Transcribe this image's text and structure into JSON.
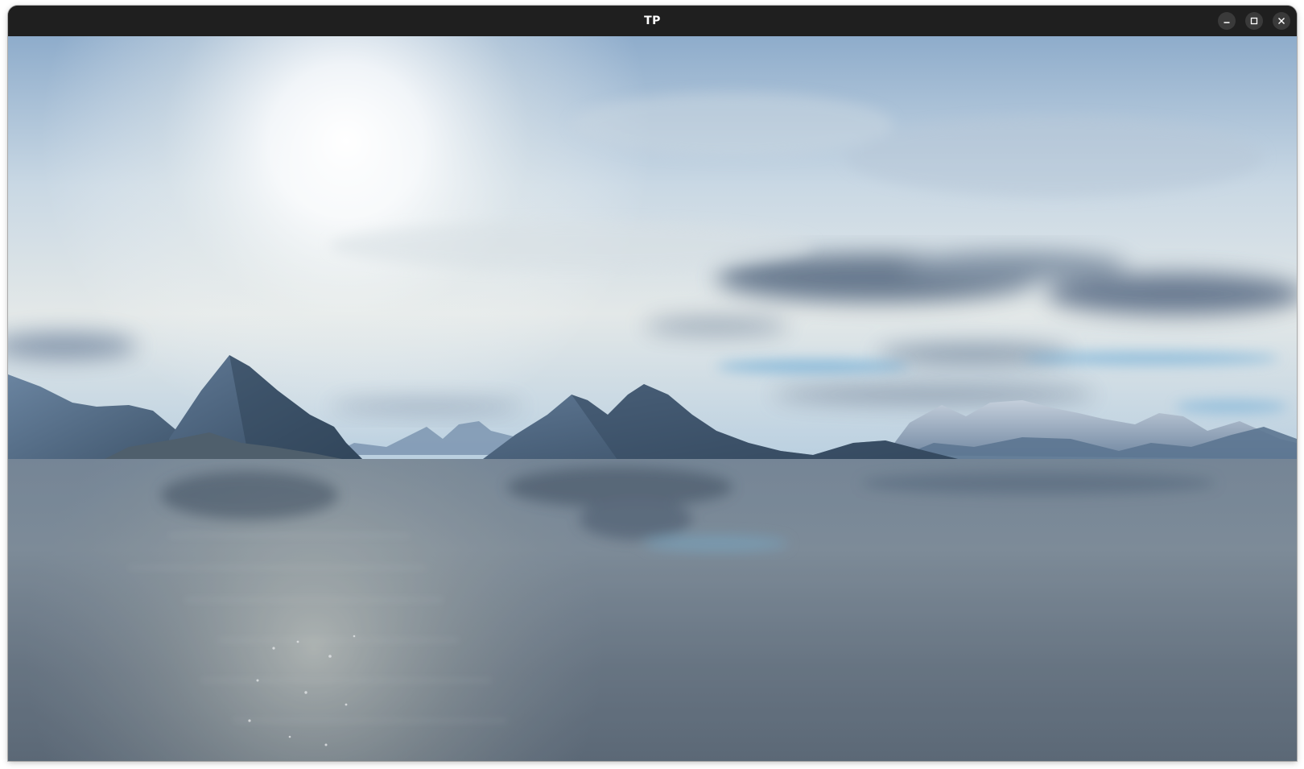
{
  "window": {
    "title": "TP",
    "controls": {
      "minimize": "minimize-icon",
      "maximize": "maximize-icon",
      "close": "close-icon"
    }
  },
  "scene": {
    "description_icon": "landscape-render",
    "colors": {
      "titlebar": "#1f1f1f",
      "sky_top": "#9fbcd8",
      "sky_mid": "#dfe8ee",
      "mountain_dark": "#3f5670",
      "mountain_mid": "#56708c",
      "water": "#6f7f90"
    }
  }
}
